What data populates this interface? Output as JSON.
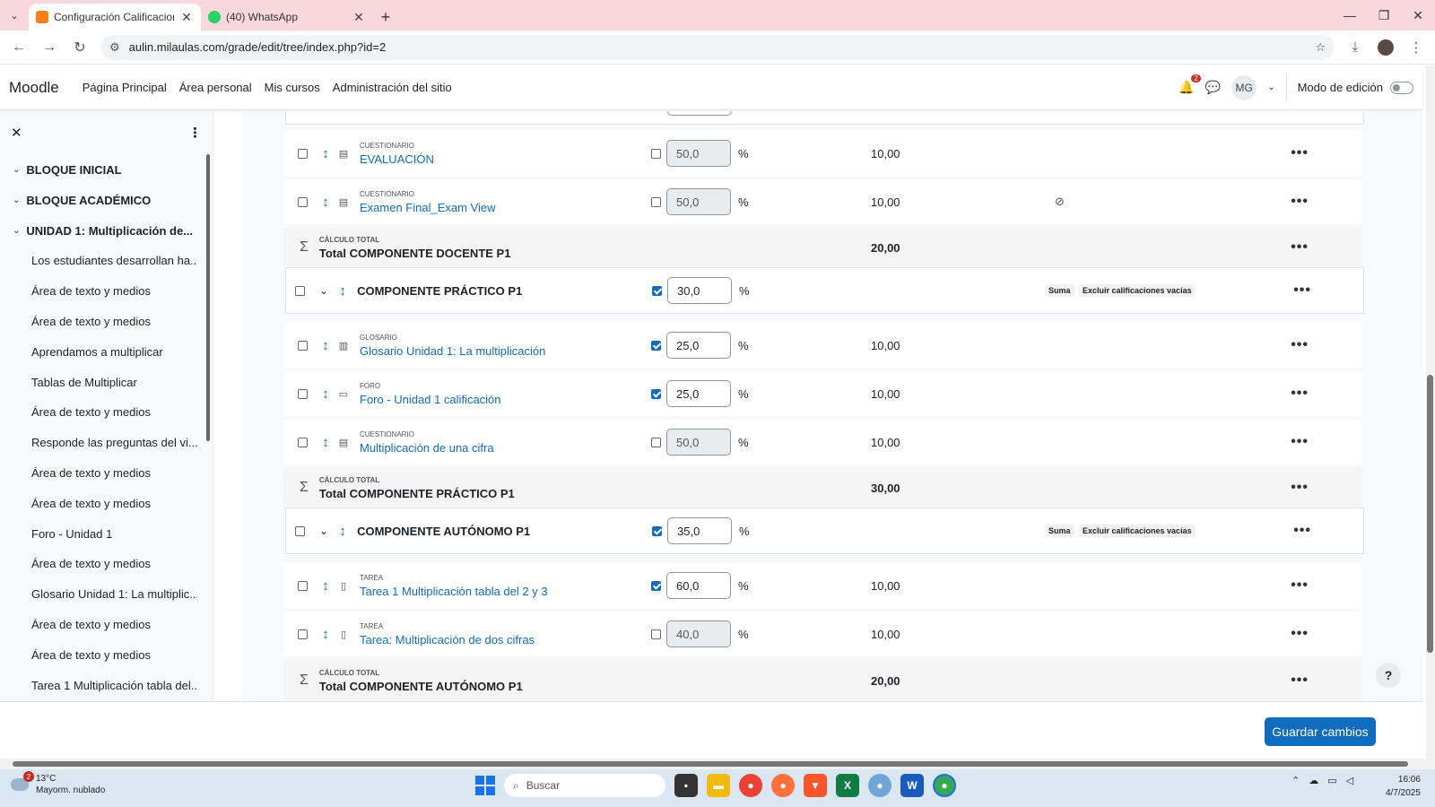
{
  "browser": {
    "tabs": [
      {
        "title": "Configuración Calificaciones | M",
        "active": true
      },
      {
        "title": "(40) WhatsApp",
        "active": false
      }
    ],
    "url": "aulin.milaulas.com/grade/edit/tree/index.php?id=2"
  },
  "nav": {
    "brand": "Moodle",
    "links": [
      "Página Principal",
      "Área personal",
      "Mis cursos",
      "Administración del sitio"
    ],
    "notification_count": "2",
    "avatar_initials": "MG",
    "edit_mode_label": "Modo de edición"
  },
  "drawer": {
    "sections": [
      "BLOQUE INICIAL",
      "BLOQUE ACADÉMICO",
      "UNIDAD 1: Multiplicación de..."
    ],
    "items": [
      "Los estudiantes desarrollan ha...",
      "Área de texto y medios",
      "Área de texto y medios",
      "Aprendamos a multiplicar",
      "Tablas de Multiplicar",
      "Área de texto y medios",
      "Responde las preguntas del vi...",
      "Área de texto y medios",
      "Área de texto y medios",
      "Foro - Unidad 1",
      "Área de texto y medios",
      "Glosario Unidad 1: La multiplic...",
      "Área de texto y medios",
      "Área de texto y medios",
      "Tarea 1 Multiplicación tabla del..."
    ]
  },
  "grades": {
    "pct_sign": "%",
    "badge_sum": "Suma",
    "badge_exclude": "Excluir calificaciones vacías",
    "total_type": "CÁLCULO TOTAL",
    "rows": [
      {
        "kind": "item",
        "type": "CUESTIONARIO",
        "name": "EVALUACIÓN",
        "checked": false,
        "weight": "50,0",
        "max": "10,00"
      },
      {
        "kind": "item",
        "type": "CUESTIONARIO",
        "name": "Examen Final_Exam View",
        "checked": false,
        "weight": "50,0",
        "max": "10,00",
        "hidden": true
      },
      {
        "kind": "total",
        "name": "Total COMPONENTE DOCENTE P1",
        "max": "20,00"
      },
      {
        "kind": "category",
        "name": "COMPONENTE PRÁCTICO P1",
        "checked": true,
        "weight": "30,0"
      },
      {
        "kind": "item",
        "type": "GLOSARIO",
        "name": "Glosario Unidad 1: La multiplicación",
        "checked": true,
        "weight": "25,0",
        "max": "10,00"
      },
      {
        "kind": "item",
        "type": "FORO",
        "name": "Foro - Unidad 1 calificación",
        "checked": true,
        "weight": "25,0",
        "max": "10,00"
      },
      {
        "kind": "item",
        "type": "CUESTIONARIO",
        "name": "Multiplicación de una cifra",
        "checked": false,
        "weight": "50,0",
        "max": "10,00"
      },
      {
        "kind": "total",
        "name": "Total COMPONENTE PRÁCTICO P1",
        "max": "30,00"
      },
      {
        "kind": "category",
        "name": "COMPONENTE AUTÓNOMO P1",
        "checked": true,
        "weight": "35,0"
      },
      {
        "kind": "item",
        "type": "TAREA",
        "name": "Tarea 1 Multiplicación tabla del 2 y 3",
        "checked": true,
        "weight": "60,0",
        "max": "10,00"
      },
      {
        "kind": "item",
        "type": "TAREA",
        "name": "Tarea: Multiplicación de dos cifras",
        "checked": false,
        "weight": "40,0",
        "max": "10,00"
      },
      {
        "kind": "total",
        "name": "Total COMPONENTE AUTÓNOMO P1",
        "max": "20,00"
      }
    ]
  },
  "footer": {
    "save_label": "Guardar cambios",
    "help": "?"
  },
  "taskbar": {
    "weather_temp": "13°C",
    "weather_desc": "Mayorm. nublado",
    "weather_badge": "2",
    "search_placeholder": "Buscar",
    "time": "16:06",
    "date": "4/7/2025"
  }
}
